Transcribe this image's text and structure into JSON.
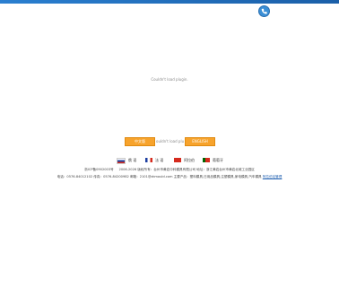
{
  "plugin_message": "Couldn't load plugin.",
  "enter_chinese": "中文版",
  "enter_english": "ENGLISH",
  "middle_message": "ouldn't load plu",
  "languages": [
    {
      "label": "俄 语"
    },
    {
      "label": "法 语"
    },
    {
      "label": "阿拉伯"
    },
    {
      "label": "葡萄牙"
    }
  ],
  "footer": {
    "line1": "浙ICP备0902003号 　 2006-2026 版权所有：台州市黄岩中科模具有限公司 地址：浙江黄岩台州市黄岩北城工业园区",
    "line2": "电话：0576-84012102 传真：0576-84200982 邮箱：2101@zkmould.com 主要产品：塑料模具,日用品模具,注塑模具,家电模具,汽车模具",
    "link": "阿拉伯站管理"
  }
}
